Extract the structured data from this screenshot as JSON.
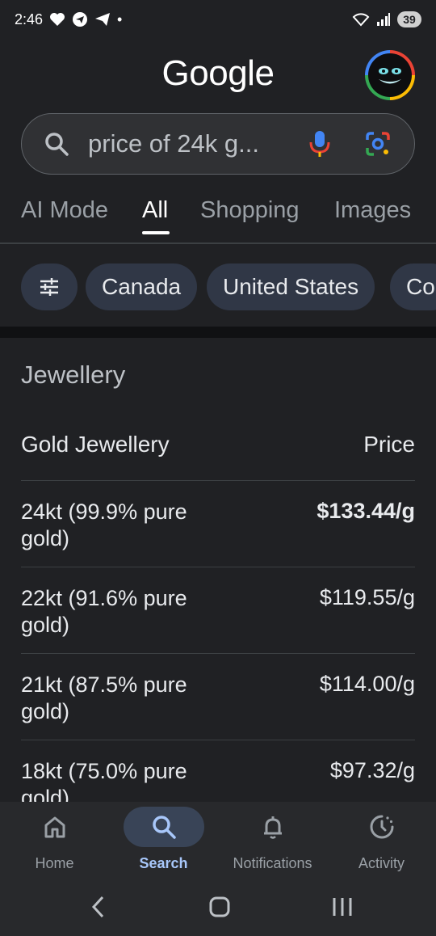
{
  "status": {
    "time": "2:46",
    "battery": "39",
    "dot": "•"
  },
  "header": {
    "logo": "Google"
  },
  "search": {
    "query": "price of 24k g..."
  },
  "tabs": [
    {
      "label": "AI Mode",
      "active": false
    },
    {
      "label": "All",
      "active": true
    },
    {
      "label": "Shopping",
      "active": false
    },
    {
      "label": "Images",
      "active": false
    }
  ],
  "chips": [
    {
      "label": "Canada"
    },
    {
      "label": "United States"
    },
    {
      "label": "Co"
    }
  ],
  "jewellery": {
    "section_title": "Jewellery",
    "col_item": "Gold Jewellery",
    "col_price": "Price",
    "rows": [
      {
        "label": "24kt (99.9% pure gold)",
        "price": "$133.44/g",
        "bold": true
      },
      {
        "label": "22kt (91.6% pure gold)",
        "price": "$119.55/g",
        "bold": false
      },
      {
        "label": "21kt (87.5% pure gold)",
        "price": "$114.00/g",
        "bold": false
      },
      {
        "label": "18kt (75.0% pure gold)",
        "price": "$97.32/g",
        "bold": false
      }
    ]
  },
  "bottom_nav": [
    {
      "label": "Home",
      "icon": "home-icon",
      "active": false
    },
    {
      "label": "Search",
      "icon": "search-icon",
      "active": true
    },
    {
      "label": "Notifications",
      "icon": "bell-icon",
      "active": false
    },
    {
      "label": "Activity",
      "icon": "activity-icon",
      "active": false
    }
  ],
  "colors": {
    "background": "#202124",
    "accent": "#a8c7fa",
    "chip": "#303746"
  }
}
